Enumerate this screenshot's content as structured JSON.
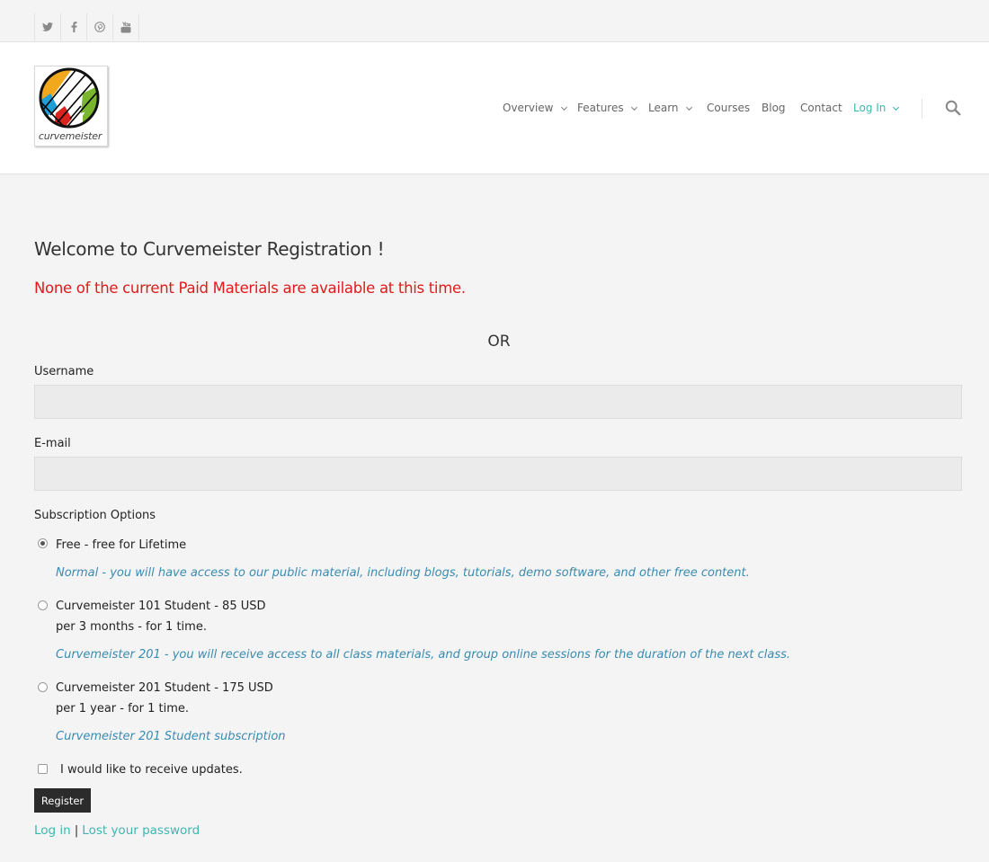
{
  "social": {
    "icons": [
      "twitter-icon",
      "facebook-icon",
      "pinterest-icon",
      "youtube-icon"
    ]
  },
  "logo": {
    "text": "curvemeister"
  },
  "nav": {
    "items": [
      {
        "label": "Overview",
        "dropdown": true
      },
      {
        "label": "Features",
        "dropdown": true
      },
      {
        "label": "Learn",
        "dropdown": true
      },
      {
        "label": "Courses",
        "dropdown": false
      },
      {
        "label": "Blog",
        "dropdown": false
      },
      {
        "label": "Contact",
        "dropdown": false
      },
      {
        "label": "Log In",
        "dropdown": true,
        "active": true
      }
    ],
    "search_icon": "search-icon"
  },
  "page": {
    "title": "Welcome to Curvemeister Registration !",
    "notice": "None of the current Paid Materials are available at this time.",
    "or": "OR"
  },
  "form": {
    "username_label": "Username",
    "username_value": "",
    "email_label": "E-mail",
    "email_value": "",
    "subscription_label": "Subscription Options",
    "options": [
      {
        "line1": "Free - free for Lifetime",
        "line2": "",
        "desc": "Normal - you will have access to our public material, including blogs, tutorials, demo software, and other free content.",
        "checked": true
      },
      {
        "line1": "Curvemeister 101 Student - 85 USD",
        "line2": "per 3 months - for 1 time.",
        "desc": "Curvemeister 201 - you will receive access to all class materials, and group online sessions for the duration of the next class.",
        "checked": false
      },
      {
        "line1": "Curvemeister 201 Student - 175 USD",
        "line2": "per 1 year - for 1 time.",
        "desc": "Curvemeister 201 Student subscription",
        "checked": false
      }
    ],
    "updates_label": "I would like to receive updates.",
    "updates_checked": false,
    "register_label": "Register"
  },
  "footer_links": {
    "login": "Log in",
    "separator": "|",
    "lost_password": "Lost your password"
  },
  "colors": {
    "accent": "#3db7b0",
    "notice": "#e01b1b",
    "description": "#3a8bb0",
    "button": "#2b2b2b"
  }
}
